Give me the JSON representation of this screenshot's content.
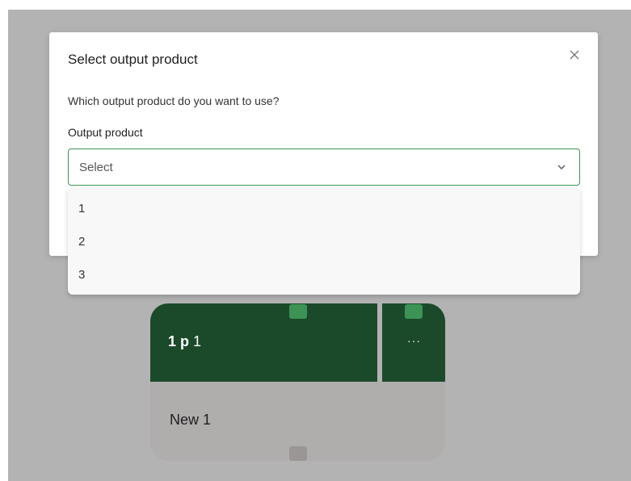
{
  "modal": {
    "title": "Select output product",
    "question": "Which output product do you want to use?",
    "field_label": "Output product",
    "select_placeholder": "Select",
    "options": [
      "1",
      "2",
      "3"
    ]
  },
  "node": {
    "title_bold": "1 p",
    "title_light": "1",
    "more_label": "···",
    "body_label": "New 1"
  },
  "colors": {
    "backdrop": "#b3b3b3",
    "node_header": "#1b4a2b",
    "accent_green": "#3c9355",
    "node_body": "#b0adad"
  },
  "icons": {
    "close": "close-icon",
    "dropdown": "chevron-down-icon",
    "more": "more-horizontal-icon"
  }
}
